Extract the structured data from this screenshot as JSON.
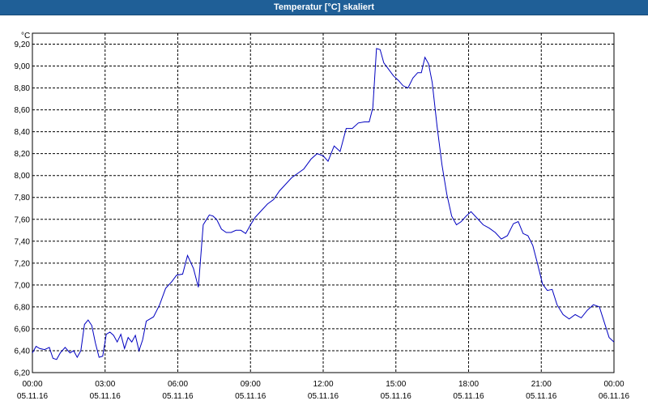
{
  "window": {
    "title": "Temperatur [°C] skaliert"
  },
  "colors": {
    "title_bar": "#1f5f97",
    "line": "#0000c0",
    "grid": "#000000",
    "background": "#ffffff"
  },
  "chart_data": {
    "type": "line",
    "title": "Temperatur [°C] skaliert",
    "ylabel": "°C",
    "xlabel": "",
    "grid": true,
    "ylim": [
      6.2,
      9.3
    ],
    "xlim": [
      0,
      24
    ],
    "y_ticks": [
      "6,20",
      "6,40",
      "6,60",
      "6,80",
      "7,00",
      "7,20",
      "7,40",
      "7,60",
      "7,80",
      "8,00",
      "8,20",
      "8,40",
      "8,60",
      "8,80",
      "9,00",
      "9,20"
    ],
    "x_ticks": [
      {
        "time": "00:00",
        "date": "05.11.16"
      },
      {
        "time": "03:00",
        "date": "05.11.16"
      },
      {
        "time": "06:00",
        "date": "05.11.16"
      },
      {
        "time": "09:00",
        "date": "05.11.16"
      },
      {
        "time": "12:00",
        "date": "05.11.16"
      },
      {
        "time": "15:00",
        "date": "05.11.16"
      },
      {
        "time": "18:00",
        "date": "05.11.16"
      },
      {
        "time": "21:00",
        "date": "05.11.16"
      },
      {
        "time": "00:00",
        "date": "06.11.16"
      }
    ],
    "series": [
      {
        "x": [
          0.0,
          0.15,
          0.3,
          0.5,
          0.7,
          0.85,
          1.0,
          1.15,
          1.35,
          1.55,
          1.7,
          1.85,
          2.0,
          2.15,
          2.3,
          2.45,
          2.6,
          2.75,
          2.9,
          3.05,
          3.2,
          3.35,
          3.5,
          3.65,
          3.8,
          3.95,
          4.1,
          4.25,
          4.4,
          4.55,
          4.7,
          4.85,
          5.0,
          5.25,
          5.5,
          5.75,
          5.95,
          6.2,
          6.4,
          6.65,
          6.85,
          7.05,
          7.3,
          7.45,
          7.6,
          7.8,
          8.0,
          8.2,
          8.4,
          8.6,
          8.8,
          9.0,
          9.2,
          9.45,
          9.7,
          9.95,
          10.2,
          10.45,
          10.7,
          10.95,
          11.2,
          11.5,
          11.75,
          12.0,
          12.2,
          12.45,
          12.7,
          12.95,
          13.2,
          13.45,
          13.7,
          13.9,
          14.05,
          14.2,
          14.35,
          14.5,
          14.7,
          14.9,
          15.1,
          15.3,
          15.5,
          15.7,
          15.9,
          16.05,
          16.2,
          16.35,
          16.5,
          16.7,
          16.9,
          17.1,
          17.3,
          17.5,
          17.7,
          17.9,
          18.1,
          18.35,
          18.6,
          18.85,
          19.1,
          19.35,
          19.6,
          19.85,
          20.05,
          20.25,
          20.45,
          20.65,
          20.85,
          21.05,
          21.25,
          21.45,
          21.65,
          21.9,
          22.15,
          22.4,
          22.65,
          22.9,
          23.15,
          23.4,
          23.6,
          23.8,
          24.0
        ],
        "y": [
          6.38,
          6.44,
          6.42,
          6.41,
          6.43,
          6.33,
          6.32,
          6.38,
          6.43,
          6.38,
          6.4,
          6.34,
          6.4,
          6.64,
          6.68,
          6.63,
          6.47,
          6.34,
          6.35,
          6.55,
          6.57,
          6.54,
          6.48,
          6.55,
          6.42,
          6.52,
          6.48,
          6.54,
          6.4,
          6.5,
          6.67,
          6.69,
          6.71,
          6.82,
          6.97,
          7.03,
          7.09,
          7.1,
          7.27,
          7.15,
          6.98,
          7.55,
          7.64,
          7.63,
          7.6,
          7.51,
          7.48,
          7.48,
          7.5,
          7.5,
          7.47,
          7.55,
          7.62,
          7.68,
          7.74,
          7.78,
          7.86,
          7.92,
          7.98,
          8.02,
          8.06,
          8.15,
          8.2,
          8.18,
          8.13,
          8.27,
          8.22,
          8.43,
          8.43,
          8.48,
          8.49,
          8.49,
          8.62,
          9.16,
          9.15,
          9.03,
          8.97,
          8.91,
          8.87,
          8.82,
          8.8,
          8.89,
          8.94,
          8.94,
          9.08,
          9.02,
          8.85,
          8.45,
          8.1,
          7.83,
          7.63,
          7.55,
          7.58,
          7.63,
          7.67,
          7.61,
          7.55,
          7.52,
          7.48,
          7.42,
          7.45,
          7.56,
          7.58,
          7.47,
          7.45,
          7.36,
          7.19,
          7.01,
          6.95,
          6.96,
          6.82,
          6.73,
          6.69,
          6.73,
          6.7,
          6.77,
          6.82,
          6.8,
          6.66,
          6.52,
          6.48
        ]
      }
    ]
  }
}
